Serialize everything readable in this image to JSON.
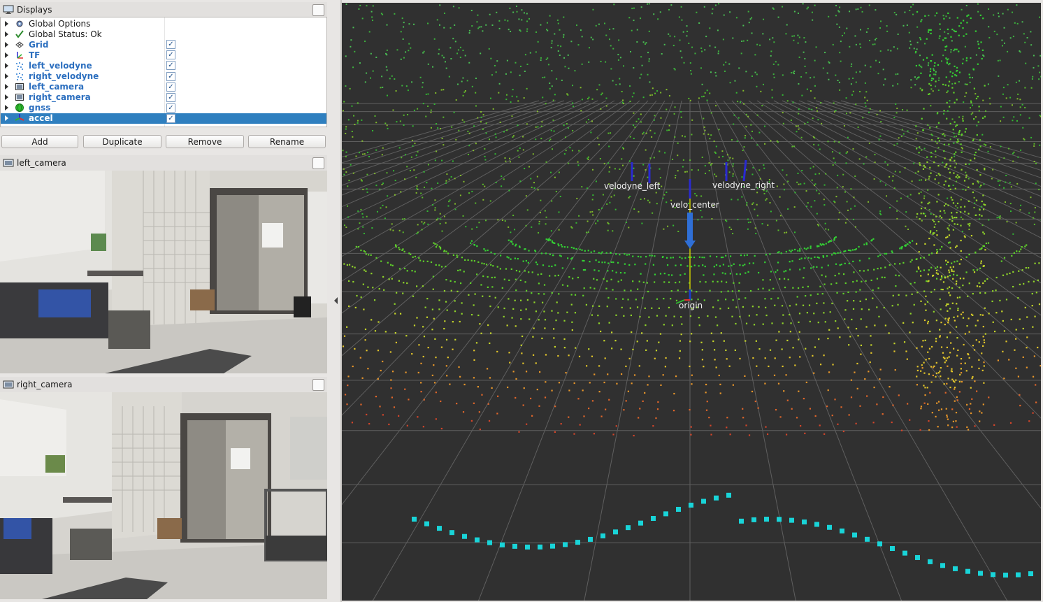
{
  "displays_panel": {
    "title": "Displays",
    "items": [
      {
        "label": "Global Options",
        "icon": "gear-icon",
        "checkbox": false,
        "style": "plain"
      },
      {
        "label": "Global Status: Ok",
        "icon": "checkmark-icon",
        "checkbox": false,
        "style": "plain"
      },
      {
        "label": "Grid",
        "icon": "grid-icon",
        "checkbox": true,
        "style": "blue"
      },
      {
        "label": "TF",
        "icon": "tf-axes-icon",
        "checkbox": true,
        "style": "blue"
      },
      {
        "label": "left_velodyne",
        "icon": "pointcloud-icon",
        "checkbox": true,
        "style": "blue"
      },
      {
        "label": "right_velodyne",
        "icon": "pointcloud-icon",
        "checkbox": true,
        "style": "blue"
      },
      {
        "label": "left_camera",
        "icon": "camera-icon",
        "checkbox": true,
        "style": "blue"
      },
      {
        "label": "right_camera",
        "icon": "camera-icon",
        "checkbox": true,
        "style": "blue"
      },
      {
        "label": "gnss",
        "icon": "gnss-icon",
        "checkbox": true,
        "style": "blue"
      },
      {
        "label": "accel",
        "icon": "accel-icon",
        "checkbox": true,
        "style": "selected"
      }
    ],
    "buttons": {
      "add": "Add",
      "duplicate": "Duplicate",
      "remove": "Remove",
      "rename": "Rename"
    }
  },
  "left_camera_panel": {
    "title": "left_camera"
  },
  "right_camera_panel": {
    "title": "right_camera"
  },
  "viewport": {
    "frame_labels": [
      "velodyne_left",
      "velodyne_right",
      "velo_center",
      "origin"
    ],
    "background": "#303030",
    "grid_color": "#6a6a6a"
  },
  "colors": {
    "selection": "#2f7fbf",
    "link_blue": "#2c6fbf"
  }
}
